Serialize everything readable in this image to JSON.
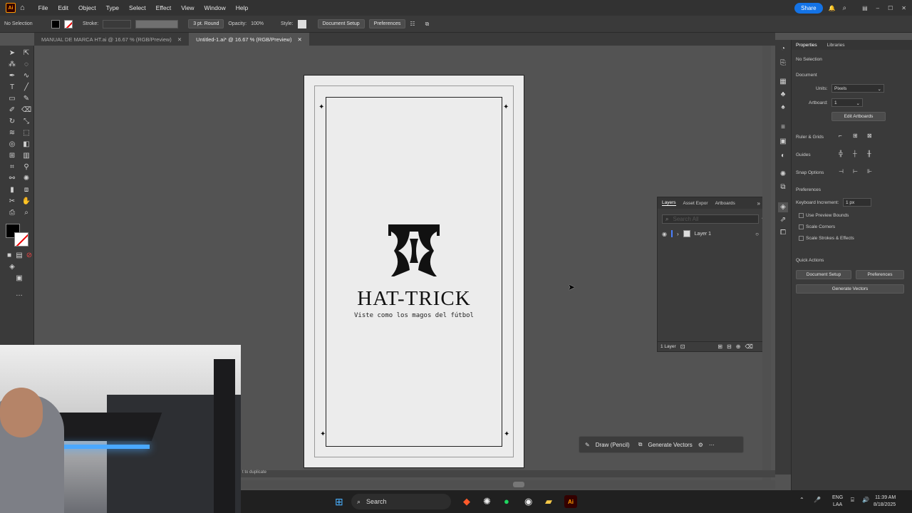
{
  "menubar": {
    "logo": "Ai",
    "items": [
      "File",
      "Edit",
      "Object",
      "Type",
      "Select",
      "Effect",
      "View",
      "Window",
      "Help"
    ],
    "share_label": "Share"
  },
  "control": {
    "selection": "No Selection",
    "stroke_label": "Stroke:",
    "brush": "3 pt. Round",
    "opacity_label": "Opacity:",
    "opacity_value": "100%",
    "style_label": "Style:",
    "doc_setup": "Document Setup",
    "preferences": "Preferences"
  },
  "tabs": [
    {
      "label": "MANUAL DE MARCA HT.ai @ 16.67 % (RGB/Preview)"
    },
    {
      "label": "Untitled-1.ai* @ 16.67 % (RGB/Preview)"
    }
  ],
  "artwork": {
    "brand": "HAT-TRICK",
    "tagline": "Viste como los magos del fútbol"
  },
  "layers": {
    "tabs": [
      "Layers",
      "Asset Expor",
      "Artboards"
    ],
    "search_placeholder": "Search All",
    "layer_name": "Layer 1",
    "count": "1 Layer"
  },
  "properties": {
    "tabs": [
      "Properties",
      "Libraries"
    ],
    "no_selection": "No Selection",
    "document": "Document",
    "units_label": "Units:",
    "units_value": "Pixels",
    "artboard_label": "Artboard:",
    "artboard_value": "1",
    "edit_artboards": "Edit Artboards",
    "ruler_grids": "Ruler & Grids",
    "guides": "Guides",
    "snap_options": "Snap Options",
    "preferences": "Preferences",
    "keyboard_inc_label": "Keyboard Increment:",
    "keyboard_inc_value": "1 px",
    "use_preview": "Use Preview Bounds",
    "scale_corners": "Scale Corners",
    "scale_strokes": "Scale Strokes & Effects",
    "quick_actions": "Quick Actions",
    "doc_setup": "Document Setup",
    "prefs_btn": "Preferences",
    "gen_vectors": "Generate Vectors"
  },
  "floatbar": {
    "draw": "Draw (Pencil)",
    "generate": "Generate Vectors"
  },
  "status": {
    "hint": "t to duplicate"
  },
  "taskbar": {
    "search": "Search",
    "lang": "ENG",
    "region": "LAA",
    "time": "11:39 AM",
    "date": "8/18/2025"
  }
}
